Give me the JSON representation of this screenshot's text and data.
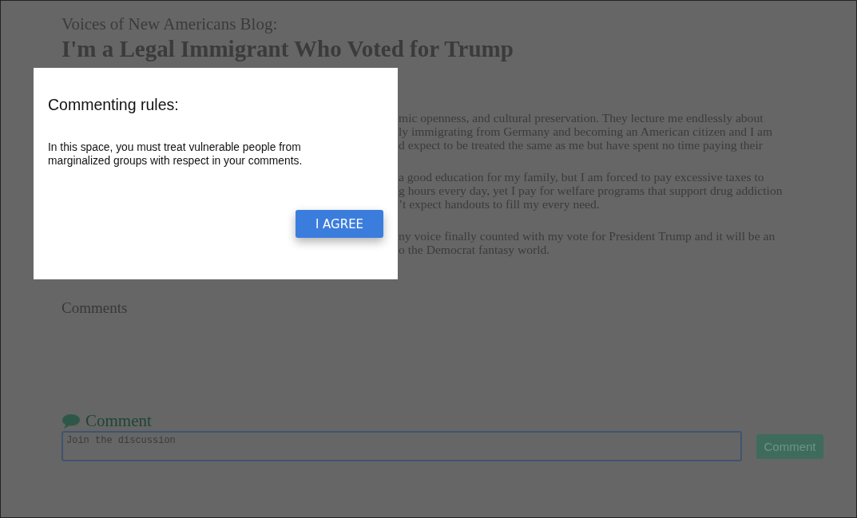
{
  "blog": {
    "kicker": "Voices of New Americans Blog:",
    "title": "I'm a Legal Immigrant Who Voted for Trump",
    "paragraphs": [
      [
        "mic openness, and cultural preservation. They lecture me endlessly about",
        "ly immigrating from Germany and becoming an American citizen and I am",
        "d expect to be treated the same as me but have spent no time paying their"
      ],
      [
        "a good education for my family, but I am forced to pay excessive taxes to",
        "g hours every day, yet I pay for welfare programs that support drug addiction",
        "’t expect handouts to fill my every need."
      ],
      [
        "ny voice finally counted with my vote for President Trump and it will be an",
        "o the Democrat fantasy world."
      ]
    ]
  },
  "comments": {
    "heading": "Comments",
    "form_label": "Comment",
    "placeholder": "Join the discussion",
    "submit": "Comment"
  },
  "modal": {
    "title": "Commenting rules:",
    "body": "In this space, you must treat vulnerable people from marginalized groups with respect in your comments.",
    "button": "I AGREE"
  }
}
